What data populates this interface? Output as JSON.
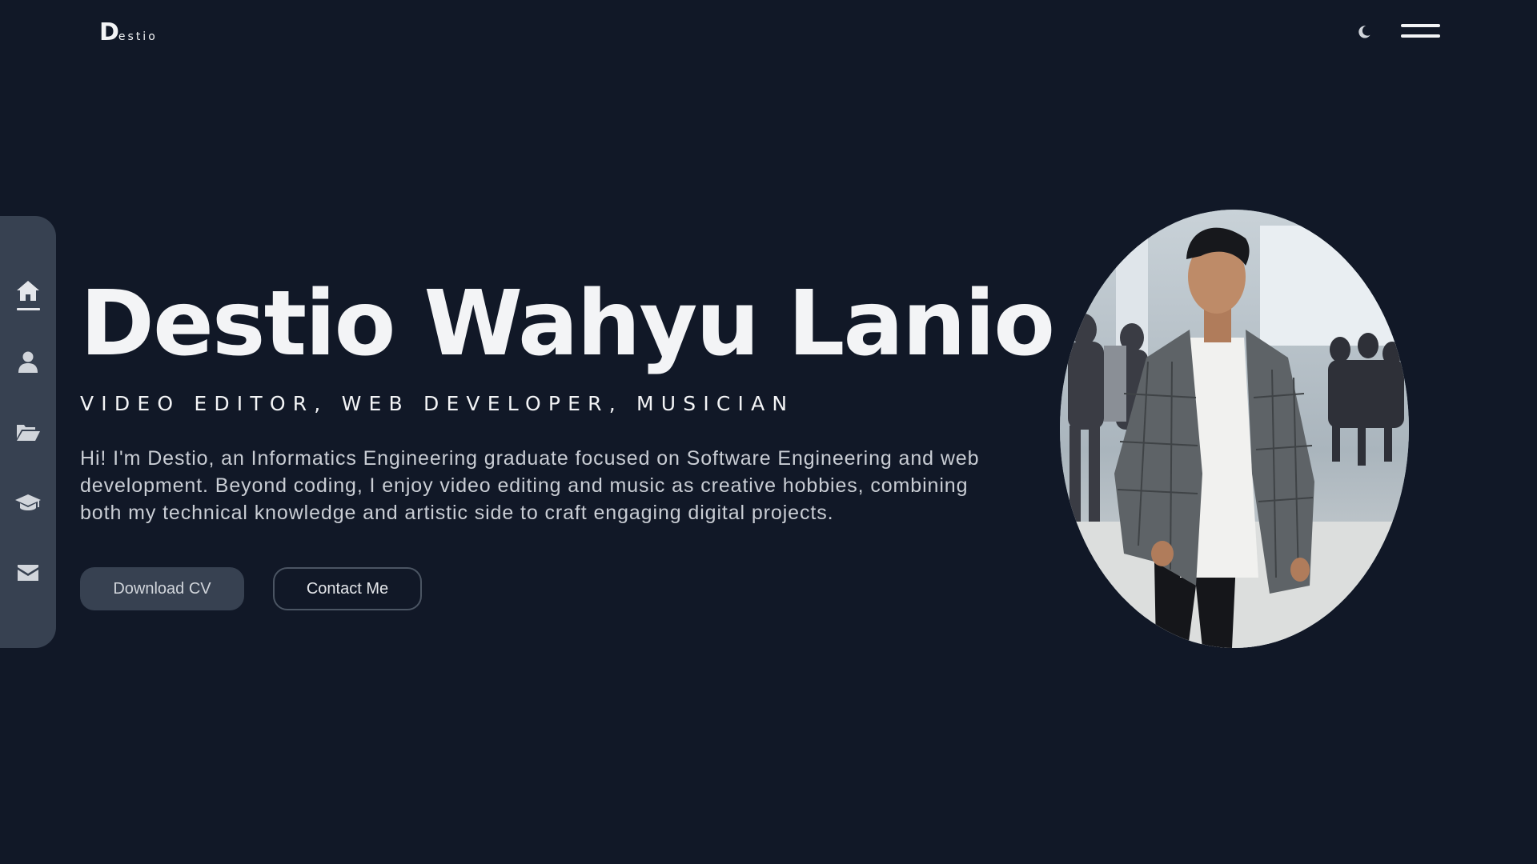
{
  "header": {
    "logo_mark": "D",
    "logo_rest": "estio",
    "theme_icon": "moon-icon",
    "menu_icon": "hamburger-menu-icon"
  },
  "sidenav": {
    "items": [
      {
        "name": "home",
        "icon": "home-icon",
        "active": true
      },
      {
        "name": "about",
        "icon": "user-icon",
        "active": false
      },
      {
        "name": "portfolio",
        "icon": "folder-open-icon",
        "active": false
      },
      {
        "name": "education",
        "icon": "graduation-cap-icon",
        "active": false
      },
      {
        "name": "contact",
        "icon": "envelope-icon",
        "active": false
      }
    ]
  },
  "hero": {
    "name": "Destio Wahyu Lanio",
    "roles": "VIDEO EDITOR, WEB DEVELOPER, MUSICIAN",
    "description": "Hi! I'm Destio, an Informatics Engineering graduate focused on Software Engineering and web development. Beyond coding, I enjoy video editing and music as creative hobbies, combining both my technical knowledge and artistic side to craft engaging digital projects.",
    "download_label": "Download CV",
    "contact_label": "Contact Me"
  },
  "colors": {
    "background": "#111827",
    "sidebar": "#374151",
    "text": "#f3f4f6",
    "muted_text": "#c9cdd4"
  }
}
